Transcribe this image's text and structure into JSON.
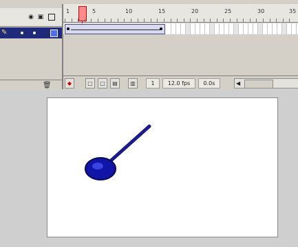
{
  "timeline": {
    "layer_header_icons": [
      "eye-icon",
      "lock-icon",
      "outline-icon"
    ],
    "ruler_labels": [
      "1",
      "5",
      "10",
      "15",
      "20",
      "25",
      "30",
      "35"
    ],
    "current_frame": "1",
    "frame_rate": "12.0 fps",
    "elapsed_time": "0.0s",
    "layer": {
      "selected": true,
      "color": "#4c6df0"
    },
    "controls": [
      "center-frame",
      "onion-skin",
      "onion-outlines",
      "edit-multiple",
      "modify-markers"
    ]
  },
  "stage": {
    "background": "#ffffff",
    "pendulum": {
      "bob_color": "#1015a8",
      "rod_color": "#1a1a88"
    }
  }
}
